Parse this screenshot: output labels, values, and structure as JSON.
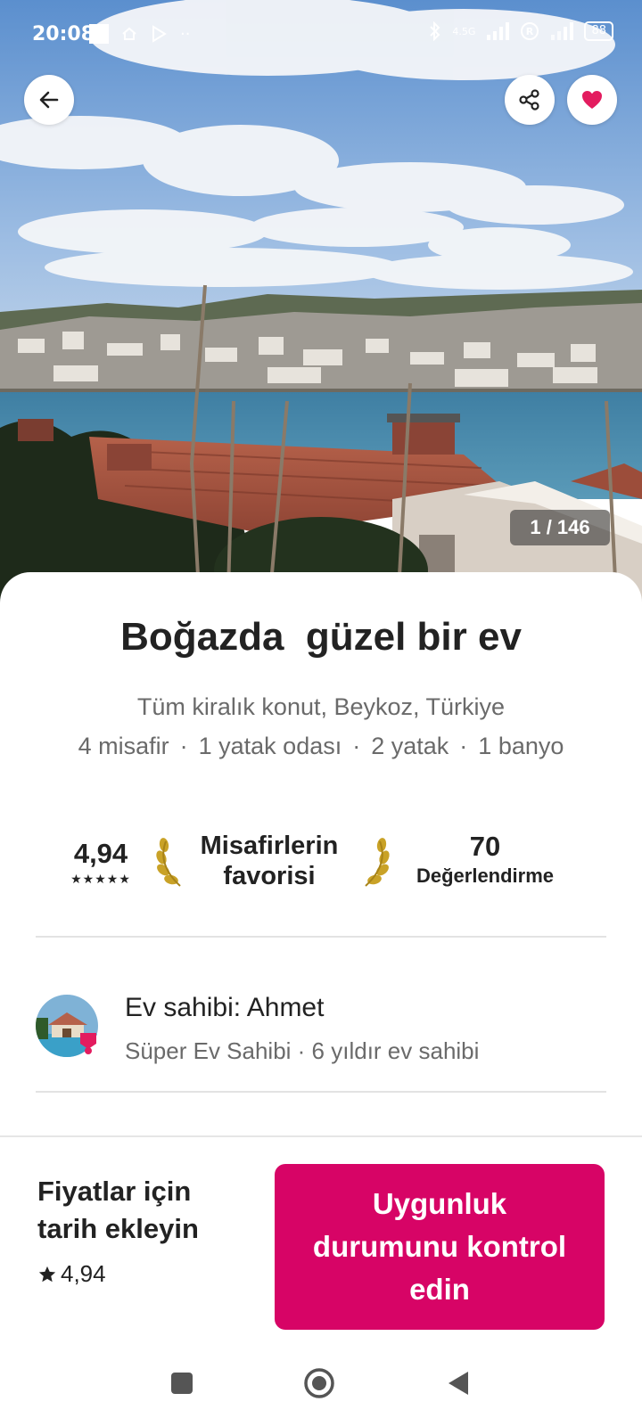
{
  "status_bar": {
    "time": "20:08",
    "network": "4.5G",
    "battery": "88"
  },
  "hero": {
    "photo_counter": "1 / 146"
  },
  "listing": {
    "title": "Boğazda  güzel bir ev",
    "subtitle": "Tüm kiralık konut, Beykoz, Türkiye",
    "details": [
      "4 misafir",
      "1 yatak odası",
      "2 yatak",
      "1 banyo"
    ],
    "details_separator": "·"
  },
  "stats": {
    "rating": "4,94",
    "stars": "★★★★★",
    "guest_favorite_line1": "Misafirlerin",
    "guest_favorite_line2": "favorisi",
    "reviews_count": "70",
    "reviews_label": "Değerlendirme"
  },
  "host": {
    "name_line": "Ev sahibi: Ahmet",
    "meta_line": "Süper Ev Sahibi · 6 yıldır ev sahibi"
  },
  "booking": {
    "price_prompt": "Fiyatlar için tarih ekleyin",
    "rating": "4,94",
    "cta_label": "Uygunluk durumunu kontrol edin"
  },
  "colors": {
    "brand": "#d70466",
    "favorite_heart": "#e31c5f",
    "muted_text": "#6a6a6a",
    "laurel_gold": "#c9a227"
  },
  "icons": {
    "back": "arrow-left-icon",
    "share": "share-icon",
    "favorite": "heart-icon",
    "laurel": "laurel-icon",
    "star": "star-icon"
  }
}
